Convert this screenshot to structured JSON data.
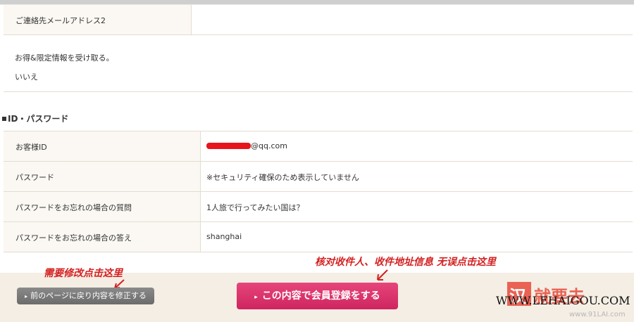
{
  "top_rows": [
    {
      "label": "ご連絡先メールアドレス2",
      "value": ""
    },
    {
      "label": "お得&限定情報を受け取る。",
      "value": "いいえ"
    }
  ],
  "section_title": "ID・パスワード",
  "account_rows": [
    {
      "label": "お客様ID",
      "value": "@qq.com"
    },
    {
      "label": "パスワード",
      "value": "※セキュリティ確保のため表示していません"
    },
    {
      "label": "パスワードをお忘れの場合の質問",
      "value": "1人旅で行ってみたい国は？"
    },
    {
      "label": "パスワードをお忘れの場合の答え",
      "value": "shanghai"
    }
  ],
  "buttons": {
    "back_label": "前のページに戻り内容を修正する",
    "register_label": "この内容で会員登録をする"
  },
  "annotations": {
    "left_note": "需要修改点击这里",
    "right_note": "核对收件人、收件地址信息 无误点击这里"
  },
  "watermark": {
    "logo_char": "汉",
    "logo_text": "就要去",
    "url": "WWW.LEHAIGOU.COM",
    "url2": "www.91LAI.com"
  },
  "colors": {
    "accent_register": "#d92d68",
    "back_button": "#777777",
    "annotation_red": "#d42020",
    "label_bg": "#fbf8f3",
    "footer_bg": "#f4eee4"
  }
}
